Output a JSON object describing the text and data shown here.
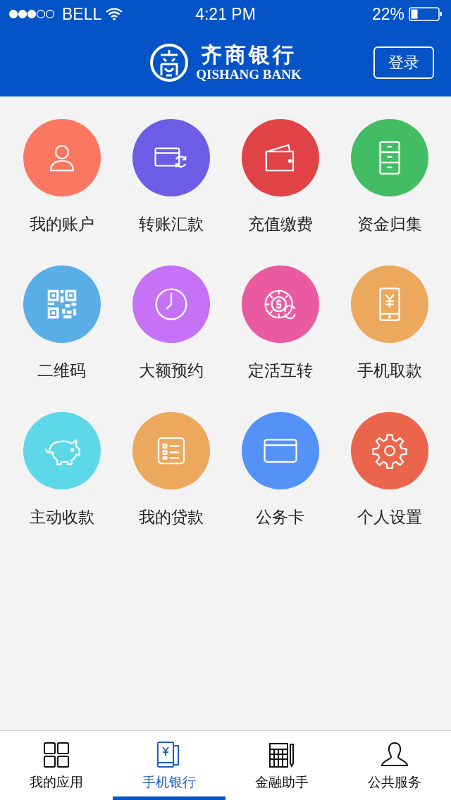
{
  "status_bar": {
    "carrier": "BELL",
    "time": "4:21 PM",
    "battery": "22%"
  },
  "header": {
    "title": "齐商银行",
    "subtitle": "QISHANG BANK",
    "login_button": "登录"
  },
  "tiles": [
    {
      "label": "我的账户",
      "kind": "user",
      "color": "#fb7762"
    },
    {
      "label": "转账汇款",
      "kind": "transfer",
      "color": "#6c5ce6"
    },
    {
      "label": "充值缴费",
      "kind": "wallet",
      "color": "#e04246"
    },
    {
      "label": "资金归集",
      "kind": "cabinet",
      "color": "#43bd63"
    },
    {
      "label": "二维码",
      "kind": "qr",
      "color": "#5aaee8"
    },
    {
      "label": "大额预约",
      "kind": "clock",
      "color": "#c572f6"
    },
    {
      "label": "定活互转",
      "kind": "coin",
      "color": "#ea5aa0"
    },
    {
      "label": "手机取款",
      "kind": "phone",
      "color": "#eca85c"
    },
    {
      "label": "主动收款",
      "kind": "piggy",
      "color": "#5cd8e8"
    },
    {
      "label": "我的贷款",
      "kind": "list",
      "color": "#eca85c"
    },
    {
      "label": "公务卡",
      "kind": "card",
      "color": "#5592f8"
    },
    {
      "label": "个人设置",
      "kind": "gear",
      "color": "#ea654c"
    }
  ],
  "tab_bar": [
    {
      "label": "我的应用",
      "kind": "grid",
      "selected": false
    },
    {
      "label": "手机银行",
      "kind": "phone",
      "selected": true
    },
    {
      "label": "金融助手",
      "kind": "calc",
      "selected": false
    },
    {
      "label": "公共服务",
      "kind": "person",
      "selected": false
    }
  ]
}
